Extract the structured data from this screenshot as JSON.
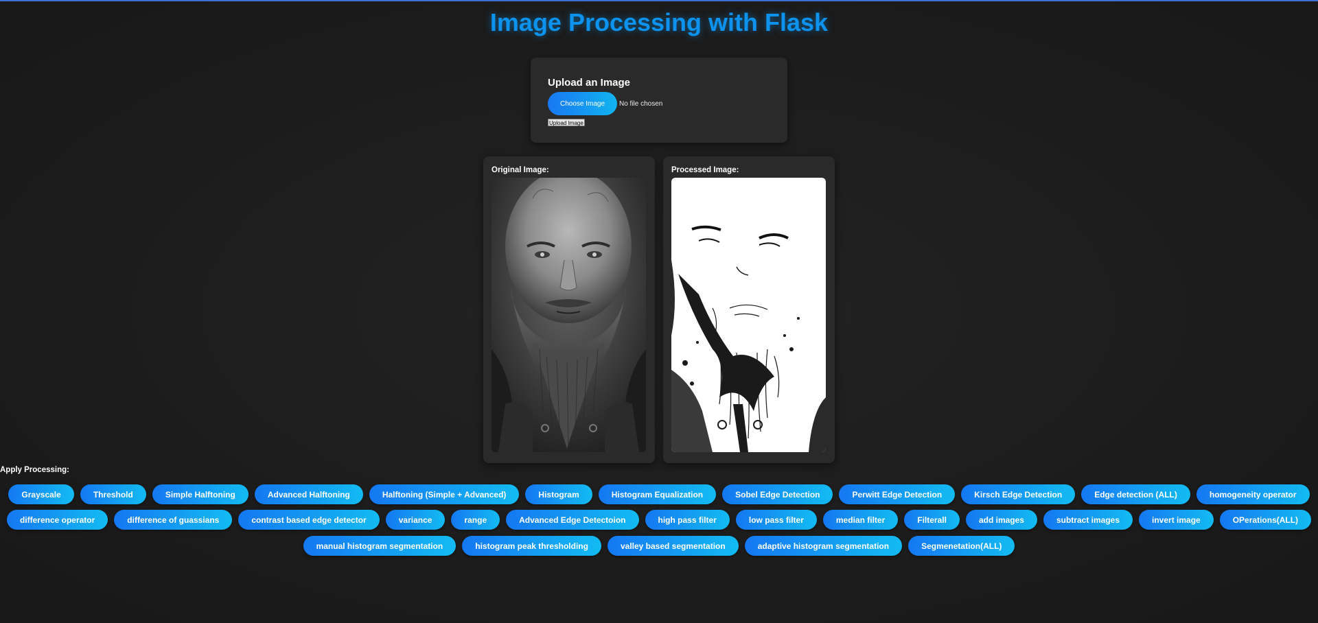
{
  "page": {
    "title": "Image Processing with Flask"
  },
  "upload": {
    "heading": "Upload an Image",
    "choose_label": "Choose Image",
    "file_status": "No file chosen",
    "upload_label": "Upload Image"
  },
  "images": {
    "original_label": "Original Image:",
    "processed_label": "Processed Image:"
  },
  "processing": {
    "label": "Apply Processing:",
    "rows": [
      [
        "Grayscale",
        "Threshold",
        "Simple Halftoning",
        "Advanced Halftoning",
        "Halftoning (Simple + Advanced)",
        "Histogram",
        "Histogram Equalization",
        "Sobel Edge Detection",
        "Perwitt Edge Detection",
        "Kirsch Edge Detection",
        "Edge detection (ALL)",
        "homogeneity operator"
      ],
      [
        "difference operator",
        "difference of guassians",
        "contrast based edge detector",
        "variance",
        "range",
        "Advanced Edge Detectoion",
        "high pass filter",
        "low pass filter",
        "median filter",
        "Filterall",
        "add images",
        "subtract images",
        "invert image",
        "OPerations(ALL)"
      ],
      [
        "manual histogram segmentation",
        "histogram peak thresholding",
        "valley based segmentation",
        "adaptive histogram segmentation",
        "Segmenetation(ALL)"
      ]
    ]
  },
  "colors": {
    "title": "#0d93ee",
    "button_start": "#1478f2",
    "button_end": "#13bbf2",
    "card": "#2a2a2a",
    "background": "#1e1e1e"
  }
}
